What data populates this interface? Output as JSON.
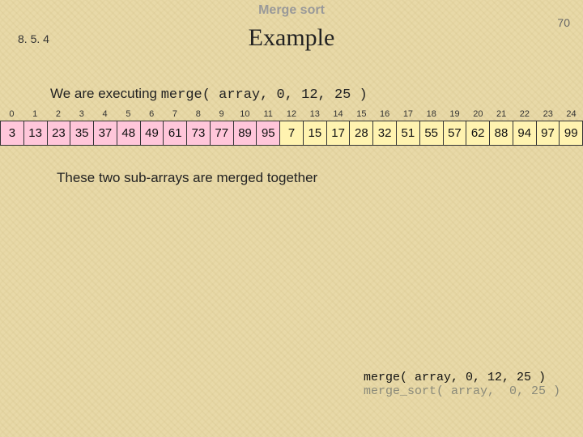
{
  "header": {
    "title": "Merge sort",
    "page_number": "70"
  },
  "section": {
    "number": "8. 5. 4",
    "title": "Example"
  },
  "exec_text": {
    "prefix": "We are executing ",
    "code": "merge( array, 0, 12, 25 )"
  },
  "array": {
    "indices": [
      "0",
      "1",
      "2",
      "3",
      "4",
      "5",
      "6",
      "7",
      "8",
      "9",
      "10",
      "11",
      "12",
      "13",
      "14",
      "15",
      "16",
      "17",
      "18",
      "19",
      "20",
      "21",
      "22",
      "23",
      "24"
    ],
    "values": [
      "3",
      "13",
      "23",
      "35",
      "37",
      "48",
      "49",
      "61",
      "73",
      "77",
      "89",
      "95",
      "7",
      "15",
      "17",
      "28",
      "32",
      "51",
      "55",
      "57",
      "62",
      "88",
      "94",
      "97",
      "99"
    ],
    "highlight_a_start": 0,
    "highlight_a_end": 11,
    "highlight_b_start": 12,
    "highlight_b_end": 24
  },
  "sub_text": "These two sub-arrays are merged together",
  "call_stack": [
    {
      "text": "merge( array, 0, 12, 25 )",
      "active": true
    },
    {
      "text": "merge_sort( array,  0, 25 )",
      "active": false
    }
  ]
}
